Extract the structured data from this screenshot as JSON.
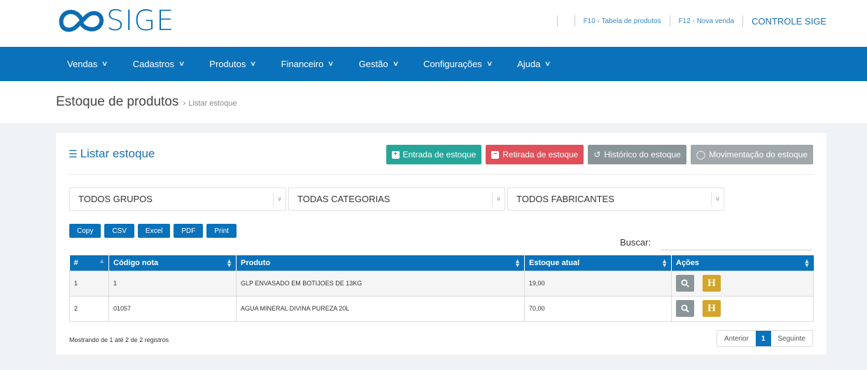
{
  "app": {
    "logo_text": "SIGE",
    "top_links": [
      "F10 - Tabela de produtos",
      "F12 - Nova venda"
    ],
    "control_link": "CONTROLE SIGE"
  },
  "nav": [
    {
      "label": "Vendas"
    },
    {
      "label": "Cadastros"
    },
    {
      "label": "Produtos"
    },
    {
      "label": "Financeiro"
    },
    {
      "label": "Gestão"
    },
    {
      "label": "Configurações"
    },
    {
      "label": "Ajuda"
    }
  ],
  "breadcrumb": {
    "title": "Estoque de produtos",
    "separator": "›",
    "current": "Listar estoque"
  },
  "panel": {
    "title": "Listar estoque",
    "buttons": {
      "entrada": "Entrada de estoque",
      "retirada": "Retirada de estoque",
      "historico": "Histórico do estoque",
      "movimentacao": "Movimentação do estoque"
    }
  },
  "filters": {
    "grupos": "TODOS GRUPOS",
    "categorias": "TODAS CATEGORIAS",
    "fabricantes": "TODOS FABRICANTES"
  },
  "export_buttons": [
    "Copy",
    "CSV",
    "Excel",
    "PDF",
    "Print"
  ],
  "search": {
    "label": "Buscar:",
    "value": ""
  },
  "table": {
    "columns": [
      "#",
      "Código nota",
      "Produto",
      "Estoque atual",
      "Ações"
    ],
    "rows": [
      {
        "num": "1",
        "codigo": "1",
        "produto": "GLP ENVASADO EM BOTIJOES DE 13KG",
        "estoque": "19,00"
      },
      {
        "num": "2",
        "codigo": "01057",
        "produto": "AGUA MINERAL DIVINA PUREZA 20L",
        "estoque": "70,00"
      }
    ],
    "action_h_label": "H"
  },
  "footer": {
    "info": "Mostrando de 1 até 2 de 2 registros",
    "prev": "Anterior",
    "page": "1",
    "next": "Seguinte"
  },
  "colors": {
    "brand_blue": "#0a72ba",
    "green": "#26a69a",
    "red": "#e0505a",
    "grey": "#8a9599",
    "gold": "#d4a52c"
  }
}
